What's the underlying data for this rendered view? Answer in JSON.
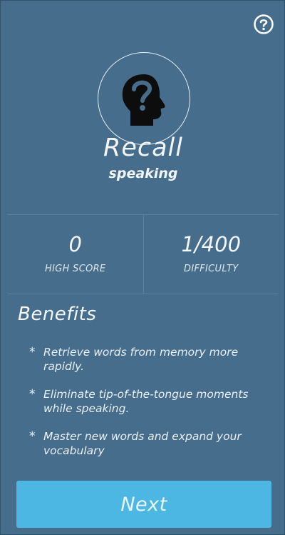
{
  "header": {
    "help_icon": "question-circle-icon"
  },
  "hero": {
    "icon": "head-question-mark-icon",
    "title": "Recall",
    "subtitle": "speaking"
  },
  "stats": [
    {
      "value": "0",
      "label": "HIGH SCORE"
    },
    {
      "value": "1/400",
      "label": "DIFFICULTY"
    }
  ],
  "benefits": {
    "title": "Benefits",
    "bullet": "*",
    "items": [
      "Retrieve words from memory more rapidly.",
      "Eliminate tip-of-the-tongue moments while speaking.",
      "Master new words and expand your vocabulary"
    ]
  },
  "actions": {
    "next_label": "Next"
  },
  "colors": {
    "background": "#466d8c",
    "button": "#4cb7e3",
    "text": "#f2f6f9"
  }
}
